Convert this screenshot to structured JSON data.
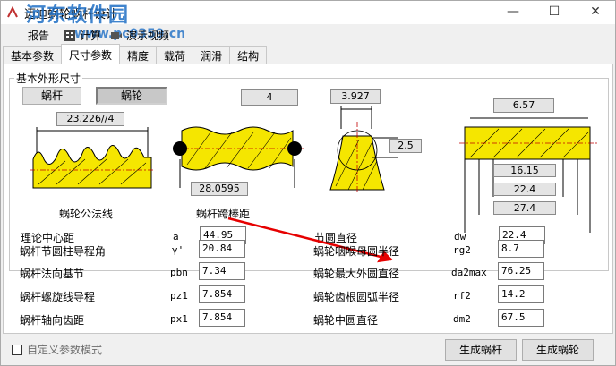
{
  "window": {
    "title": "迈迪蜗轮蜗杆设计",
    "watermark": "河东软件园",
    "watermark_url": "www.pc0359.cn",
    "controls": {
      "minimize": "—",
      "maximize": "☐",
      "close": "✕"
    }
  },
  "toolbar": {
    "report": "报告",
    "calculate": "计算",
    "demo_video": "演示视频"
  },
  "tabs": [
    {
      "label": "基本参数"
    },
    {
      "label": "尺寸参数"
    },
    {
      "label": "精度"
    },
    {
      "label": "载荷"
    },
    {
      "label": "润滑"
    },
    {
      "label": "结构"
    }
  ],
  "group": {
    "title": "基本外形尺寸",
    "worm_button": "蜗杆",
    "wheel_button": "蜗轮"
  },
  "diagrams": {
    "normal_line_value": "23.226//4",
    "normal_line_caption": "蜗轮公法线",
    "bar_count": "4",
    "span_value": "28.0595",
    "span_caption": "蜗杆跨棒距",
    "tooth_top": "3.927",
    "tooth_side": "2.5",
    "wheel_top": "6.57",
    "wheel_d1": "16.15",
    "wheel_d2": "22.4",
    "wheel_d3": "27.4"
  },
  "params_left": [
    {
      "label": "理论中心距",
      "symbol": "a",
      "value": "44.95"
    },
    {
      "label": "蜗杆节圆柱导程角",
      "symbol": "γ'",
      "value": "20.84"
    },
    {
      "label": "蜗杆法向基节",
      "symbol": "pbn",
      "value": "7.34"
    },
    {
      "label": "蜗杆螺旋线导程",
      "symbol": "pz1",
      "value": "7.854"
    },
    {
      "label": "蜗杆轴向齿距",
      "symbol": "px1",
      "value": "7.854"
    }
  ],
  "params_right": [
    {
      "label": "节圆直径",
      "symbol": "dw",
      "value": "22.4"
    },
    {
      "label": "蜗轮咽喉母圆半径",
      "symbol": "rg2",
      "value": "8.7"
    },
    {
      "label": "蜗轮最大外圆直径",
      "symbol": "da2max",
      "value": "76.25"
    },
    {
      "label": "蜗轮齿根圆弧半径",
      "symbol": "rf2",
      "value": "14.2"
    },
    {
      "label": "蜗轮中圆直径",
      "symbol": "dm2",
      "value": "67.5"
    }
  ],
  "footer": {
    "custom_mode": "自定义参数模式",
    "gen_worm": "生成蜗杆",
    "gen_wheel": "生成蜗轮"
  },
  "colors": {
    "fill": "#f5e600",
    "annotation": "#e60000",
    "watermark": "#1f6fc5"
  }
}
